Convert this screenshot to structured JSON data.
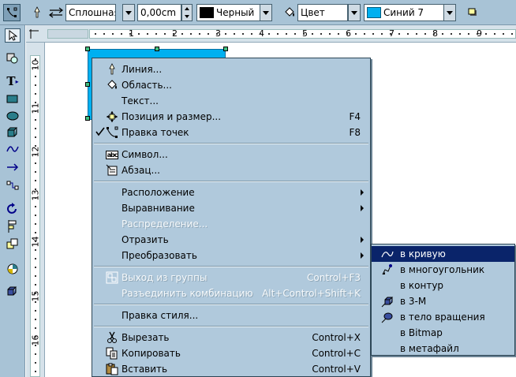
{
  "toolbar": {
    "line_style_value": "Сплошная",
    "line_width_value": "0,00cm",
    "line_color_value": "Черный",
    "line_color_swatch": "#000000",
    "area_style_value": "Цвет",
    "area_color_value": "Синий 7",
    "area_color_swatch": "#00b0f0",
    "icons": [
      "points-edit-icon",
      "line-icon",
      "arrow-style-icon",
      "paint-bucket-icon",
      "shadow-icon"
    ]
  },
  "rulers": {
    "horizontal": [
      "1",
      "2",
      "3",
      "4",
      "5",
      "6",
      "7",
      "8",
      "9"
    ],
    "vertical": [
      "10",
      "11",
      "12",
      "13",
      "14",
      "15",
      "16"
    ]
  },
  "shape": {
    "fill": "#00b0f0"
  },
  "context_menu": {
    "items": [
      {
        "label": "Линия...",
        "mnemonic": "Л",
        "icon": "line-icon"
      },
      {
        "label": "Область...",
        "mnemonic": "О",
        "icon": "area-icon"
      },
      {
        "label": "Текст...",
        "mnemonic": "Т"
      },
      {
        "label": "Позиция и размер...",
        "mnemonic": "П",
        "shortcut": "F4",
        "icon": "position-size-icon"
      },
      {
        "label": "Правка точек",
        "shortcut": "F8",
        "checked": true,
        "icon": "edit-points-icon"
      },
      {
        "label": "Символ...",
        "mnemonic": "С",
        "icon": "character-icon"
      },
      {
        "label": "Абзац...",
        "mnemonic": "А",
        "icon": "paragraph-icon"
      },
      {
        "label": "Расположение",
        "submenu": true
      },
      {
        "label": "Выравнивание",
        "submenu": true
      },
      {
        "label": "Распределение...",
        "disabled": true
      },
      {
        "label": "Отразить",
        "submenu": true
      },
      {
        "label": "Преобразовать",
        "submenu": true
      },
      {
        "label": "Выход из группы",
        "shortcut": "Control+F3",
        "disabled": true,
        "icon": "exit-group-icon"
      },
      {
        "label": "Разъединить комбинацию",
        "shortcut": "Alt+Control+Shift+K",
        "disabled": true
      },
      {
        "label": "Правка стиля..."
      },
      {
        "label": "Вырезать",
        "shortcut": "Control+X",
        "icon": "scissors-icon"
      },
      {
        "label": "Копировать",
        "shortcut": "Control+C",
        "icon": "copy-icon"
      },
      {
        "label": "Вставить",
        "shortcut": "Control+V",
        "icon": "paste-icon"
      }
    ]
  },
  "submenu": {
    "items": [
      {
        "label": "в кривую",
        "highlighted": true,
        "icon": "curve-icon"
      },
      {
        "label": "в многоугольник",
        "icon": "polygon-icon"
      },
      {
        "label": "в контур"
      },
      {
        "label": "в 3-М",
        "icon": "three-d-icon"
      },
      {
        "label": "в тело вращения",
        "icon": "rotation-body-icon"
      },
      {
        "label": "в Bitmap"
      },
      {
        "label": "в метафайл"
      }
    ]
  }
}
